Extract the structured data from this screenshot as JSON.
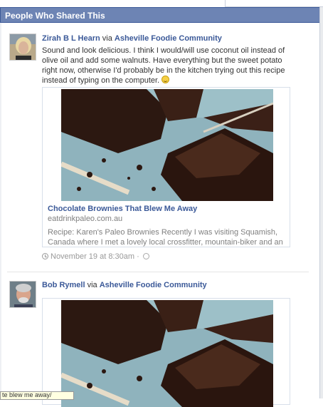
{
  "dialog": {
    "title": "People Who Shared This"
  },
  "posts": [
    {
      "author": "Zirah B L Hearn",
      "via": "via",
      "page": "Asheville Foodie Community",
      "message": "Sound and look delicious. I think I would/will use coconut oil instead of olive oil and add some walnuts. Have everything but the sweet potato right now, otherwise I'd probably be in the kitchen trying out this recipe instead of typing on the computer.",
      "attachment": {
        "title": "Chocolate Brownies That Blew Me Away",
        "domain": "eatdrinkpaleo.com.au",
        "description": "Recipe: Karen's Paleo Brownies Recently I was visiting Squamish, Canada where I met a lovely local crossfitter, mountain-biker and an overall awesome chi"
      },
      "meta": {
        "time": "November 19 at 8:30am",
        "separator": "·"
      }
    },
    {
      "author": "Bob Rymell",
      "via": "via",
      "page": "Asheville Foodie Community"
    }
  ],
  "tooltip": {
    "text": "te blew me away/"
  },
  "icons": [
    "smiley-icon",
    "clock-icon",
    "globe-icon"
  ],
  "colors": {
    "header_bg": "#6d84b4",
    "link": "#3b5998",
    "tooltip_bg": "#ffffe1"
  }
}
